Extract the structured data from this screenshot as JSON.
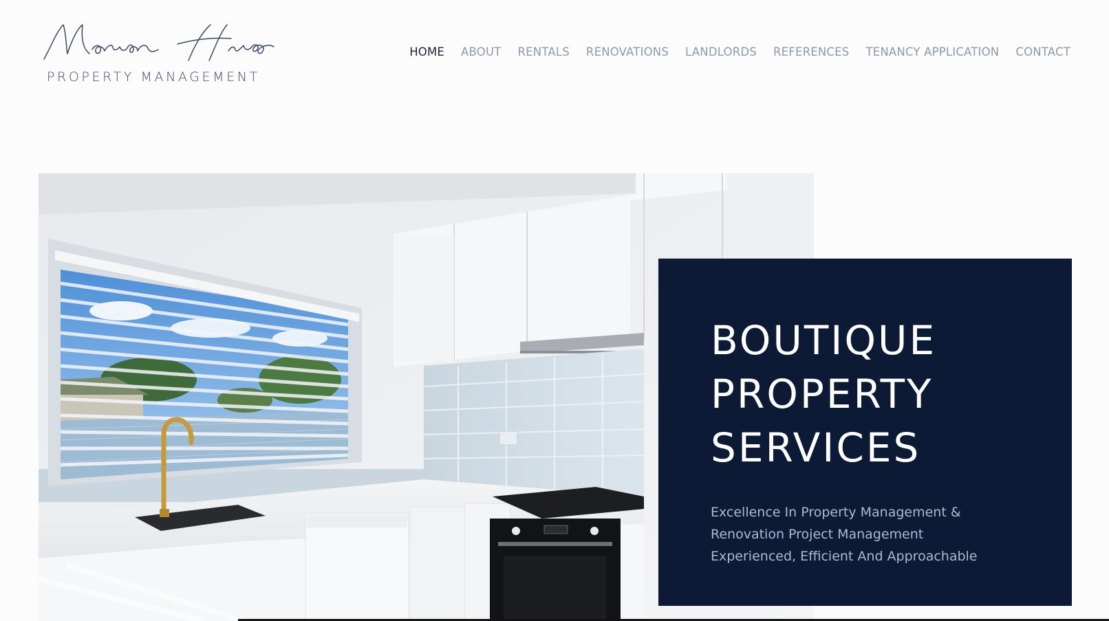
{
  "brand": {
    "script_name": "Marian Hines",
    "subtitle": "PROPERTY MANAGEMENT"
  },
  "nav": {
    "items": [
      {
        "label": "HOME",
        "active": true
      },
      {
        "label": "ABOUT"
      },
      {
        "label": "RENTALS"
      },
      {
        "label": "RENOVATIONS"
      },
      {
        "label": "LANDLORDS"
      },
      {
        "label": "REFERENCES"
      },
      {
        "label": "TENANCY APPLICATION"
      },
      {
        "label": "CONTACT"
      }
    ]
  },
  "hero": {
    "image_subject": "white kitchen with window, gold tap, tiled splashback and oven",
    "title_lines": [
      "BOUTIQUE",
      "PROPERTY",
      "SERVICES"
    ],
    "tagline_lines": [
      "Excellence In Property Management &",
      "Renovation Project Management",
      "Experienced, Efficient And Approachable"
    ]
  },
  "colors": {
    "background": "#fcfcfd",
    "card": "#0c1a35",
    "nav_text": "#8c9aaa",
    "nav_active": "#1d2330",
    "tagline": "#aebacb",
    "logo": "#3b4a63"
  },
  "icons": {
    "logo": "signature-logo"
  }
}
